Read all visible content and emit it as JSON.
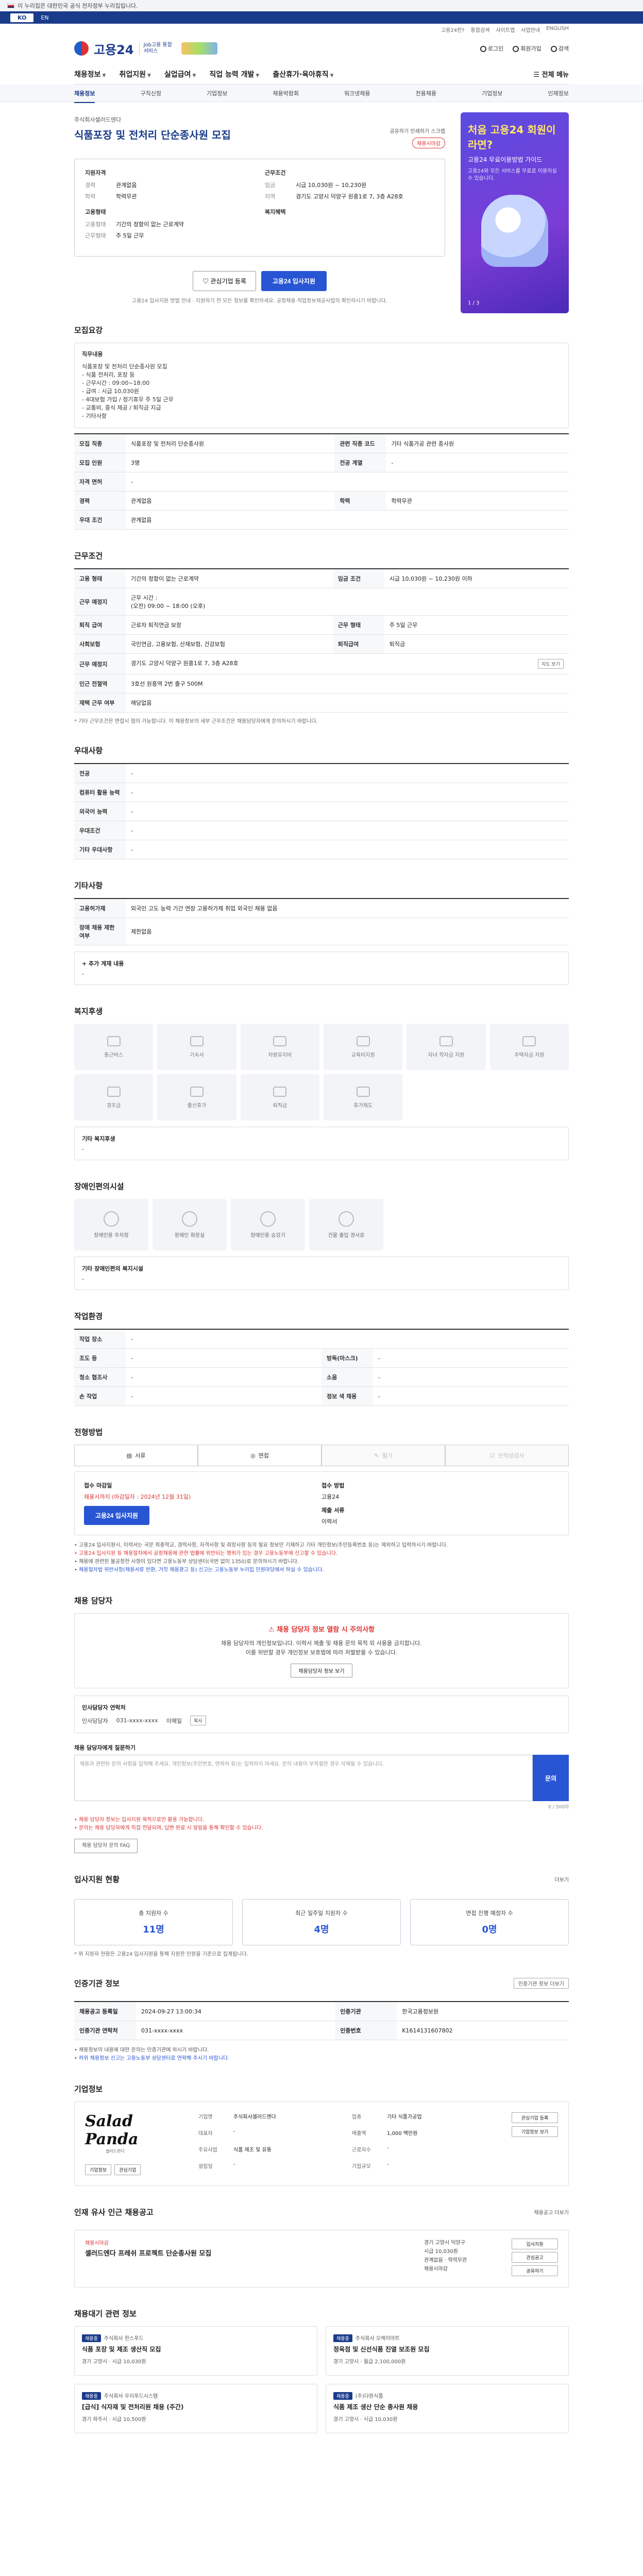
{
  "gov_banner": "이 누리집은 대한민국 공식 전자정부 누리집입니다.",
  "lang": {
    "ko": "KO",
    "en": "EN"
  },
  "top_links": [
    "고용24란?",
    "통합검색",
    "사이트맵",
    "사업안내",
    "ENGLISH"
  ],
  "header": {
    "logo": "고용24",
    "logo_sub": "Job고용 통합 서비스",
    "login": "로그인",
    "signup": "회원가입",
    "search": "검색"
  },
  "gnb": {
    "items": [
      "채용정보",
      "취업지원",
      "실업급여",
      "직업 능력 개발",
      "출산휴가·육아휴직"
    ],
    "all_menu": "전체 메뉴"
  },
  "subnav": [
    "채용정보",
    "구직신청",
    "기업정보",
    "채용박람회",
    "워크넷채용",
    "전용채용",
    "기업정보",
    "인재정보"
  ],
  "side_banner": {
    "t1": "처음 고용24 회원이라면?",
    "t2": "고용24 무료이용방법 가이드",
    "t3": "고용24와 모든 서비스를 무료로 이용하실 수 있습니다.",
    "pager": "1 / 3"
  },
  "job": {
    "company": "주식회사셀러드엔다",
    "title": "식품포장 및 전처리 단순종사원 모집",
    "share": "공유하기  인쇄하기  스크랩",
    "closing": "채용시마감",
    "apply_section_title": "지원자격",
    "conditions_title": "근무조건",
    "rows_left": [
      {
        "k": "경력",
        "v": "관계없음"
      },
      {
        "k": "학력",
        "v": "학력무관"
      }
    ],
    "employ_title": "고용형태",
    "rows_left2": [
      {
        "k": "고용형태",
        "v": "기간의 정함이 없는 근로계약"
      },
      {
        "k": "근무형태",
        "v": "주 5일 근무"
      }
    ],
    "rows_right": [
      {
        "k": "임금",
        "v": "시급 10,030원 ~ 10,230원"
      },
      {
        "k": "지역",
        "v": "경기도 고양시 덕양구 원흥1로 7, 3층 A28호"
      }
    ],
    "welfare_title": "복지혜택",
    "btn_scrap": "관심기업 등록",
    "btn_apply": "고용24 입사지원",
    "notice": "고용24 입사지원 방법 안내 · 지원하기 전 모든 정보를 확인하세요.  공정채용·직업정보제공사업의 확인하시기 바랍니다."
  },
  "recruit": {
    "title": "모집요강",
    "duty_label": "직무내용",
    "duties": [
      "식품포장 및 전처리 단순종사원 모집",
      "- 식품 전처리, 포장 등",
      "- 근무시간 : 09:00~18:00",
      "- 급여 : 시급 10,030원",
      "- 4대보험 가입 / 정기휴무 주 5일 근무",
      "- 교통비, 중식 제공 / 퇴직금 지급",
      "- 기타사항"
    ],
    "rows": [
      {
        "k1": "모집 직종",
        "v1": "식품포장 및 전처리 단순종사원",
        "k2": "관련 직종 코드",
        "v2": "기타 식품가공 관련 종사원"
      },
      {
        "k1": "모집 인원",
        "v1": "3명",
        "k2": "전공 계열",
        "v2": "-"
      },
      {
        "k1": "자격 면허",
        "v1": "-",
        "k2": "",
        "v2": ""
      },
      {
        "k1": "경력",
        "v1": "관계없음",
        "k2": "학력",
        "v2": "학력무관"
      },
      {
        "k1": "우대 조건",
        "v1": "관계없음",
        "k2": "",
        "v2": ""
      }
    ]
  },
  "work": {
    "title": "근무조건",
    "rows": [
      {
        "k1": "고용 형태",
        "v1": "기간의 정함이 없는 근로계약",
        "k2": "임금 조건",
        "v2": "시급 10,030원 ~ 10,230원 이하"
      },
      {
        "k1": "근무 예정지",
        "v1": "근무 시간 :\n(오전) 09:00 ~ 18:00 (오후)",
        "k2": "",
        "v2": ""
      },
      {
        "k1": "퇴직 급여",
        "v1": "근로자 퇴직연금 보장",
        "k2": "근무 형태",
        "v2": "주 5일 근무"
      },
      {
        "k1": "사회보험",
        "v1": "국민연금, 고용보험, 산재보험, 건강보험",
        "k2": "퇴직급여",
        "v2": "퇴직금"
      },
      {
        "k1": "근무 예정지",
        "v1": "경기도 고양시 덕양구 원흥1로 7, 3층 A28호",
        "k2": "",
        "v2": ""
      },
      {
        "k1": "인근 전철역",
        "v1": "3호선 원흥역 2번 출구 500M",
        "k2": "",
        "v2": ""
      },
      {
        "k1": "재택 근무 여부",
        "v1": "해당없음",
        "k2": "",
        "v2": ""
      }
    ],
    "map_btn": "지도 보기",
    "note": "* 기타 근무조건은 면접시 협의 가능합니다. 이 채용정보의 세부 근무조건은 채용담당자에게 문의하시기 바랍니다."
  },
  "pref": {
    "title": "우대사항",
    "rows": [
      {
        "k": "전공",
        "v": "-"
      },
      {
        "k": "컴퓨터 활용 능력",
        "v": "-"
      },
      {
        "k": "외국어 능력",
        "v": "-"
      },
      {
        "k": "우대조건",
        "v": "-"
      },
      {
        "k": "기타 우대사항",
        "v": "-"
      }
    ]
  },
  "etc": {
    "title": "기타사항",
    "rows": [
      {
        "k": "고용허가제",
        "v": "외국인 고도 능력 기간 연장 고용허가제 취업 외국인 채용 없음"
      },
      {
        "k": "장애 채용 제한 여부",
        "v": "제한없음"
      }
    ],
    "extra_label": "+ 추가 게재 내용",
    "extra_value": "-"
  },
  "welfare": {
    "title": "복지후생",
    "items": [
      "통근버스",
      "기숙사",
      "차량유지비",
      "교육비지원",
      "자녀 학자금 지원",
      "주택자금 지원",
      "경조금",
      "출산휴가",
      "퇴직금",
      "휴가제도"
    ],
    "etc_label": "기타 복지후생",
    "etc_value": "-"
  },
  "disability": {
    "title": "장애인편의시설",
    "items": [
      "장애인용 주차장",
      "장애인 화장실",
      "장애인용 승강기",
      "건물 출입 경사로"
    ],
    "etc_label": "기타 장애인편의 복지시설",
    "etc_value": "-"
  },
  "env": {
    "title": "작업환경",
    "rows": [
      {
        "k1": "작업 장소",
        "v1": "-",
        "k2": "",
        "v2": ""
      },
      {
        "k1": "조도 등",
        "v1": "-",
        "k2": "방독(마스크)",
        "v2": "-"
      },
      {
        "k1": "청소 협조사",
        "v1": "-",
        "k2": "소음",
        "v2": "-"
      },
      {
        "k1": "손 작업",
        "v1": "-",
        "k2": "정보 색 채용",
        "v2": "-"
      }
    ]
  },
  "method": {
    "title": "전형방법",
    "tabs": [
      "서류",
      "면접",
      "필기",
      "인적성검사"
    ],
    "deadline_label": "접수 마감일",
    "deadline": "채용시까지 (마감일자 : 2024년 12월 31일)",
    "apply_label": "접수 방법",
    "apply_value": "고용24",
    "submit_label": "제출 서류",
    "submit_value": "이력서",
    "btn_apply": "고용24 입사지원",
    "notes": [
      "• 고용24 입사지원시, 이력서는 국문 최종학교, 경력사항, 자격사항 및 희망사항 등의 필요 정보만 기재하고 기타 개인정보(주민등록번호 등)는 제외하고 입력하시기 바랍니다.",
      "• 고용24 입사지원 등 채용절차에서 공정채용에 관한 법률에 위반되는 행위가 있는 경우 고용노동부에 신고할 수 있습니다.",
      "• 채용에 관련된 불공정한 사항이 있다면 고용노동부 상담센터(국번 없이 1350)로 문의하시기 바랍니다.",
      "• 채용절차법 위반사항(채용서류 반환, 거짓 채용광고 등) 신고는 고용노동부 누리집 민원마당에서 하실 수 있습니다."
    ]
  },
  "contact": {
    "title": "채용 담당자",
    "warn_title": "채용 담당자 정보 열람 시 주의사항",
    "warn_text": "채용 담당자의 개인정보입니다. 이력서 제출 및 채용 문의 목적 외 사용을 금지합니다.\n이를 위반할 경우 개인정보 보호법에 따라 처벌받을 수 있습니다.",
    "warn_btn": "채용담당자 정보 보기",
    "head": "인사담당자 연락처",
    "name_label": "인사담당자",
    "phone": "031-xxxx-xxxx",
    "email_label": "이메일",
    "copy": "복사",
    "inquiry_label": "채용 담당자에게 질문하기",
    "inquiry_placeholder": "채용과 관련된 문의 사항을 입력해 주세요. 개인정보(주민번호, 연락처 등)는 입력하지 마세요. 문의 내용이 부적절한 경우 삭제될 수 있습니다.",
    "inquiry_btn": "문의",
    "counter": "0 / 500자",
    "bottom_notes": [
      "• 채용 담당자 정보는 입사지원 목적으로만 활용 가능합니다.",
      "• 문의는 채용 담당자에게 직접 전달되며, 답변 완료 시 알림을 통해 확인할 수 있습니다."
    ],
    "faq_btn": "채용 담당자 문의 FAQ"
  },
  "stats": {
    "title": "입사지원 현황",
    "more": "더보기",
    "cards": [
      {
        "label": "총 지원자 수",
        "value": "11명"
      },
      {
        "label": "최근 일주일 지원자 수",
        "value": "4명"
      },
      {
        "label": "면접 진행 예정자 수",
        "value": "0명"
      }
    ],
    "note": "* 위 지원자 현황은 고용24 입사지원을 통해 지원한 인원을 기준으로 집계됩니다."
  },
  "reg": {
    "title": "인증기관 정보",
    "right_btn": "인증기관 정보 더보기",
    "rows": [
      {
        "k1": "채용공고 등록일",
        "v1": "2024-09-27 13:00:34",
        "k2": "인증기관",
        "v2": "한국고용정보원"
      },
      {
        "k1": "인증기관 연락처",
        "v1": "031-xxxx-xxxx",
        "k2": "인증번호",
        "v2": "K1614131607802"
      }
    ],
    "notes": [
      "• 채용정보의 내용에 대한 문의는 인증기관에 하시기 바랍니다.",
      "• 허위 채용정보 신고는 고용노동부 상담센터로 연락해 주시기 바랍니다."
    ]
  },
  "company": {
    "title": "기업정보",
    "logo_text": "Salad Panda",
    "logo_tag": "샐러드판다",
    "btn_info": "기업정보",
    "btn_scrap": "관심기업",
    "fields": [
      {
        "k": "기업명",
        "v": "주식회사셀러드엔다"
      },
      {
        "k": "업종",
        "v": "기타 식품가공업"
      },
      {
        "k": "대표자",
        "v": "-"
      },
      {
        "k": "매출액",
        "v": "1,000 백만원"
      },
      {
        "k": "주요사업",
        "v": "식품 제조 및 유통"
      },
      {
        "k": "근로자수",
        "v": "-"
      },
      {
        "k": "설립일",
        "v": "-"
      },
      {
        "k": "기업규모",
        "v": "-"
      }
    ],
    "side_btns": [
      "관심기업 등록",
      "기업정보 보기"
    ]
  },
  "other": {
    "title": "인재 유사 인근 채용공고",
    "more": "채용공고 더보기",
    "badge": "채용시마감",
    "item_title": "셀러드엔다 프레쉬 프로젝트 단순종사원 모집",
    "mid": [
      "경기 고양시 덕양구",
      "시급 10,030원",
      "관계없음 · 학력무관",
      "채용시마감"
    ],
    "side_btns": [
      "입사지원",
      "관심공고",
      "공유하기"
    ]
  },
  "similar": {
    "title": "채용대기 관련 정보",
    "cards": [
      {
        "tag": "채용중",
        "co": "주식회사 한스푸드",
        "title": "식품 포장 및 제조 생산직 모집",
        "meta": "경기 고양시 · 시급 10,030원"
      },
      {
        "tag": "채용중",
        "co": "주식회사 오케이마트",
        "title": "정육점 및 신선식품 진열 보조원 모집",
        "meta": "경기 고양시 · 월급 2,100,000원"
      },
      {
        "tag": "채용중",
        "co": "주식회사 우리푸드시스템",
        "title": "[급식] 식자재 및 전처리원 채용 (주간)",
        "meta": "경기 파주시 · 시급 10,500원"
      },
      {
        "tag": "채용중",
        "co": "(주)다원식품",
        "title": "식품 제조 생산 단순 종사원 채용",
        "meta": "경기 고양시 · 시급 10,030원"
      }
    ]
  }
}
